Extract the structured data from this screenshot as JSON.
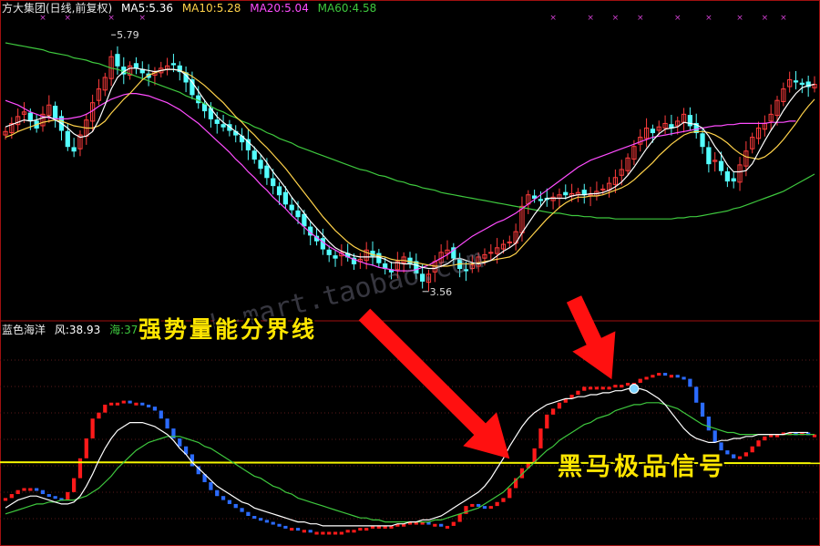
{
  "colors": {
    "background": "#000000",
    "frame": "#a01010",
    "grid": "#5a1a1a",
    "up_candle": "#ff3c3c",
    "down_candle": "#54ffff",
    "ma5": "#ffffff",
    "ma10": "#ffd24a",
    "ma20": "#ff4cff",
    "ma60": "#3ec83e",
    "osc_up": "#ff1a1a",
    "osc_down": "#2b6bff",
    "osc_fast": "#ffffff",
    "osc_slow": "#3ec83e",
    "threshold": "#f5f500",
    "arrow": "#ff1010",
    "signal_dot": "#7fd4ff",
    "marker": "#d040d0"
  },
  "top_panel": {
    "title": "方大集团(日线,前复权)",
    "ma5_label": "MA5:5.36",
    "ma10_label": "MA10:5.28",
    "ma20_label": "MA20:5.04",
    "ma60_label": "MA60:4.58",
    "high_label": "5.79",
    "low_label": "3.56"
  },
  "bottom_panel": {
    "title": "蓝色海洋",
    "feng_label": "风:38.93",
    "hai_label": "海:37.04"
  },
  "annotations": {
    "left_text": "强势量能分界线",
    "right_text": "黑马极品信号",
    "watermark": "zb-mart.taobao.com"
  },
  "chart_data": [
    {
      "type": "candlestick",
      "title": "方大集团(日线,前复权)",
      "series_names": [
        "MA5",
        "MA10",
        "MA20",
        "MA60"
      ],
      "ylim": [
        3.4,
        5.95
      ],
      "extremes": {
        "high": 5.79,
        "low": 3.56
      },
      "close": [
        4.95,
        5.02,
        5.08,
        5.12,
        5.05,
        4.98,
        5.1,
        5.18,
        5.06,
        4.96,
        4.82,
        4.78,
        4.92,
        5.05,
        5.2,
        5.32,
        5.42,
        5.6,
        5.52,
        5.45,
        5.52,
        5.5,
        5.46,
        5.42,
        5.47,
        5.5,
        5.52,
        5.53,
        5.47,
        5.38,
        5.27,
        5.2,
        5.13,
        5.06,
        5.02,
        4.99,
        4.96,
        4.92,
        4.86,
        4.79,
        4.71,
        4.63,
        4.55,
        4.48,
        4.4,
        4.32,
        4.27,
        4.21,
        4.13,
        4.05,
        4.0,
        3.93,
        3.88,
        3.85,
        3.9,
        3.86,
        3.8,
        3.84,
        3.92,
        3.87,
        3.81,
        3.76,
        3.73,
        3.82,
        3.86,
        3.8,
        3.72,
        3.65,
        3.71,
        3.82,
        3.9,
        3.92,
        3.85,
        3.76,
        3.74,
        3.79,
        3.86,
        3.88,
        3.9,
        3.94,
        3.97,
        3.99,
        4.08,
        4.3,
        4.4,
        4.37,
        4.35,
        4.36,
        4.38,
        4.4,
        4.4,
        4.41,
        4.42,
        4.4,
        4.4,
        4.43,
        4.45,
        4.5,
        4.55,
        4.62,
        4.72,
        4.82,
        4.9,
        4.98,
        4.94,
        4.99,
        5.02,
        4.98,
        5.04,
        5.1,
        5.0,
        4.94,
        4.82,
        4.67,
        4.7,
        4.61,
        4.52,
        4.52,
        4.66,
        4.78,
        4.9,
        4.98,
        5.02,
        5.1,
        5.22,
        5.32,
        5.4,
        5.38,
        5.36,
        5.34,
        5.36
      ],
      "ma5": [
        4.99,
        5.01,
        5.03,
        5.05,
        5.04,
        5.05,
        5.07,
        5.08,
        5.05,
        5.02,
        4.98,
        4.93,
        4.9,
        4.91,
        4.95,
        5.05,
        5.18,
        5.32,
        5.42,
        5.47,
        5.5,
        5.5,
        5.49,
        5.48,
        5.47,
        5.48,
        5.49,
        5.49,
        5.48,
        5.44,
        5.38,
        5.3,
        5.22,
        5.15,
        5.08,
        5.03,
        4.99,
        4.95,
        4.91,
        4.86,
        4.81,
        4.75,
        4.68,
        4.6,
        4.53,
        4.46,
        4.38,
        4.31,
        4.24,
        4.17,
        4.11,
        4.05,
        3.99,
        3.94,
        3.91,
        3.89,
        3.87,
        3.86,
        3.86,
        3.86,
        3.86,
        3.84,
        3.81,
        3.81,
        3.8,
        3.8,
        3.79,
        3.77,
        3.76,
        3.76,
        3.78,
        3.8,
        3.84,
        3.85,
        3.83,
        3.81,
        3.8,
        3.81,
        3.83,
        3.87,
        3.91,
        3.94,
        3.98,
        4.07,
        4.15,
        4.23,
        4.3,
        4.37,
        4.37,
        4.37,
        4.37,
        4.39,
        4.4,
        4.4,
        4.41,
        4.41,
        4.42,
        4.44,
        4.47,
        4.51,
        4.57,
        4.64,
        4.72,
        4.8,
        4.87,
        4.93,
        4.97,
        4.98,
        4.99,
        5.03,
        5.02,
        5.01,
        4.98,
        4.91,
        4.82,
        4.75,
        4.66,
        4.6,
        4.6,
        4.61,
        4.67,
        4.77,
        4.87,
        4.96,
        5.04,
        5.13,
        5.21,
        5.28,
        5.33,
        5.35,
        5.36
      ],
      "ma10": [
        4.9,
        4.92,
        4.95,
        4.97,
        4.99,
        5.01,
        5.03,
        5.04,
        5.05,
        5.04,
        5.02,
        5.0,
        4.99,
        4.98,
        4.98,
        5.0,
        5.04,
        5.11,
        5.17,
        5.23,
        5.28,
        5.34,
        5.4,
        5.44,
        5.46,
        5.48,
        5.49,
        5.49,
        5.48,
        5.46,
        5.43,
        5.39,
        5.35,
        5.3,
        5.25,
        5.2,
        5.14,
        5.08,
        5.03,
        4.97,
        4.92,
        4.86,
        4.81,
        4.75,
        4.69,
        4.63,
        4.56,
        4.49,
        4.42,
        4.35,
        4.28,
        4.21,
        4.15,
        4.09,
        4.04,
        3.99,
        3.95,
        3.92,
        3.9,
        3.88,
        3.87,
        3.86,
        3.84,
        3.83,
        3.83,
        3.82,
        3.81,
        3.8,
        3.79,
        3.78,
        3.78,
        3.78,
        3.79,
        3.8,
        3.8,
        3.8,
        3.81,
        3.82,
        3.83,
        3.84,
        3.85,
        3.86,
        3.89,
        3.95,
        4.01,
        4.07,
        4.13,
        4.19,
        4.24,
        4.29,
        4.33,
        4.36,
        4.38,
        4.38,
        4.39,
        4.39,
        4.4,
        4.42,
        4.44,
        4.46,
        4.49,
        4.53,
        4.58,
        4.63,
        4.68,
        4.74,
        4.79,
        4.84,
        4.88,
        4.92,
        4.94,
        4.95,
        4.95,
        4.94,
        4.92,
        4.89,
        4.85,
        4.8,
        4.76,
        4.73,
        4.72,
        4.71,
        4.73,
        4.77,
        4.82,
        4.88,
        4.95,
        5.02,
        5.1,
        5.17,
        5.23
      ],
      "ma20": [
        5.22,
        5.2,
        5.18,
        5.15,
        5.12,
        5.1,
        5.08,
        5.07,
        5.06,
        5.06,
        5.06,
        5.07,
        5.08,
        5.1,
        5.13,
        5.17,
        5.2,
        5.23,
        5.25,
        5.27,
        5.28,
        5.28,
        5.27,
        5.26,
        5.24,
        5.22,
        5.2,
        5.17,
        5.14,
        5.1,
        5.06,
        5.02,
        4.97,
        4.92,
        4.87,
        4.82,
        4.77,
        4.71,
        4.66,
        4.6,
        4.55,
        4.49,
        4.44,
        4.38,
        4.33,
        4.28,
        4.22,
        4.17,
        4.12,
        4.07,
        4.03,
        3.99,
        3.95,
        3.92,
        3.89,
        3.86,
        3.84,
        3.82,
        3.8,
        3.79,
        3.77,
        3.76,
        3.75,
        3.74,
        3.74,
        3.74,
        3.75,
        3.77,
        3.79,
        3.82,
        3.85,
        3.88,
        3.92,
        3.96,
        4.0,
        4.04,
        4.07,
        4.1,
        4.13,
        4.16,
        4.18,
        4.21,
        4.24,
        4.28,
        4.32,
        4.36,
        4.4,
        4.44,
        4.48,
        4.52,
        4.56,
        4.6,
        4.64,
        4.67,
        4.7,
        4.72,
        4.74,
        4.76,
        4.78,
        4.8,
        4.82,
        4.84,
        4.86,
        4.88,
        4.9,
        4.91,
        4.92,
        4.93,
        4.94,
        4.95,
        4.96,
        4.97,
        4.98,
        4.99,
        5.0,
        5.0,
        5.01,
        5.01,
        5.02,
        5.02,
        5.02,
        5.02,
        5.02,
        5.03,
        5.03,
        5.03,
        5.04,
        5.04
      ],
      "ma60": [
        5.72,
        5.71,
        5.7,
        5.69,
        5.68,
        5.67,
        5.66,
        5.64,
        5.63,
        5.62,
        5.61,
        5.59,
        5.58,
        5.57,
        5.55,
        5.54,
        5.52,
        5.5,
        5.49,
        5.47,
        5.45,
        5.43,
        5.41,
        5.39,
        5.37,
        5.35,
        5.33,
        5.31,
        5.29,
        5.26,
        5.24,
        5.22,
        5.19,
        5.17,
        5.14,
        5.12,
        5.09,
        5.07,
        5.04,
        5.02,
        4.99,
        4.97,
        4.94,
        4.92,
        4.89,
        4.87,
        4.85,
        4.82,
        4.8,
        4.78,
        4.76,
        4.74,
        4.72,
        4.7,
        4.68,
        4.66,
        4.64,
        4.62,
        4.61,
        4.59,
        4.57,
        4.56,
        4.54,
        4.52,
        4.51,
        4.49,
        4.48,
        4.46,
        4.45,
        4.44,
        4.42,
        4.41,
        4.4,
        4.39,
        4.38,
        4.37,
        4.36,
        4.35,
        4.34,
        4.33,
        4.32,
        4.31,
        4.3,
        4.29,
        4.28,
        4.27,
        4.26,
        4.25,
        4.24,
        4.24,
        4.23,
        4.22,
        4.22,
        4.21,
        4.21,
        4.2,
        4.2,
        4.2,
        4.19,
        4.19,
        4.19,
        4.19,
        4.19,
        4.19,
        4.19,
        4.19,
        4.19,
        4.19,
        4.2,
        4.2,
        4.21,
        4.21,
        4.22,
        4.23,
        4.24,
        4.25,
        4.26,
        4.28,
        4.29,
        4.31,
        4.33,
        4.35,
        4.37,
        4.39,
        4.41,
        4.43,
        4.46,
        4.49,
        4.52,
        4.55,
        4.58
      ]
    },
    {
      "type": "line",
      "title": "蓝色海洋",
      "series": [
        {
          "name": "风",
          "last": 38.93
        },
        {
          "name": "海",
          "last": 37.04
        }
      ],
      "ylim": [
        0,
        100
      ],
      "threshold": 38,
      "fast": [
        15,
        17,
        19,
        20,
        21,
        21,
        20,
        19,
        18,
        17,
        17,
        18,
        21,
        26,
        32,
        39,
        45,
        50,
        54,
        56,
        58,
        58,
        58,
        57,
        56,
        54,
        52,
        49,
        45,
        42,
        38,
        35,
        32,
        29,
        26,
        24,
        22,
        20,
        18,
        17,
        15,
        14,
        13,
        12,
        11,
        10,
        9,
        8,
        8,
        7,
        7,
        6,
        6,
        6,
        6,
        6,
        6,
        6,
        6,
        6,
        6,
        6,
        6,
        7,
        7,
        8,
        8,
        9,
        9,
        10,
        11,
        13,
        15,
        17,
        19,
        21,
        23,
        26,
        30,
        35,
        40,
        46,
        51,
        56,
        60,
        63,
        65,
        67,
        68,
        69,
        70,
        70,
        71,
        71,
        72,
        72,
        73,
        73,
        74,
        74,
        75,
        75,
        75,
        74,
        72,
        70,
        67,
        63,
        59,
        55,
        52,
        50,
        49,
        48,
        48,
        49,
        49,
        50,
        50,
        51,
        51,
        52,
        52,
        52,
        52,
        52,
        53,
        53,
        53,
        53
      ],
      "slow": [
        12,
        13,
        14,
        15,
        16,
        17,
        17,
        18,
        18,
        19,
        19,
        19,
        20,
        21,
        23,
        25,
        28,
        31,
        35,
        38,
        41,
        44,
        46,
        48,
        49,
        50,
        51,
        51,
        51,
        50,
        49,
        48,
        46,
        45,
        43,
        41,
        39,
        37,
        35,
        33,
        31,
        30,
        28,
        26,
        25,
        23,
        22,
        20,
        19,
        18,
        17,
        16,
        15,
        14,
        13,
        12,
        11,
        10,
        10,
        9,
        9,
        8,
        8,
        8,
        8,
        8,
        8,
        8,
        8,
        9,
        9,
        10,
        11,
        12,
        13,
        14,
        15,
        17,
        19,
        21,
        23,
        26,
        29,
        32,
        35,
        38,
        41,
        44,
        46,
        49,
        51,
        53,
        55,
        57,
        58,
        60,
        61,
        62,
        64,
        65,
        66,
        67,
        67,
        68,
        68,
        68,
        67,
        66,
        65,
        63,
        61,
        59,
        57,
        56,
        55,
        54,
        53,
        53,
        52,
        52,
        52,
        52,
        52,
        52,
        52,
        52,
        52,
        52,
        52,
        52,
        52
      ],
      "signal": [
        20,
        22,
        24,
        25,
        25,
        24,
        22,
        21,
        20,
        19,
        23,
        30,
        40,
        50,
        60,
        63,
        67,
        68,
        68,
        69,
        68,
        68,
        67,
        66,
        64,
        60,
        55,
        50,
        46,
        42,
        36,
        32,
        28,
        24,
        21,
        19,
        17,
        15,
        13,
        11,
        10,
        9,
        8,
        7,
        6,
        5,
        5,
        4,
        4,
        3,
        3,
        3,
        3,
        3,
        3,
        4,
        4,
        5,
        5,
        6,
        6,
        6,
        6,
        7,
        7,
        8,
        8,
        8,
        7,
        7,
        6,
        6,
        8,
        12,
        16,
        17,
        16,
        15,
        16,
        18,
        20,
        25,
        30,
        35,
        38,
        45,
        55,
        62,
        65,
        68,
        70,
        72,
        74,
        76,
        76,
        76,
        76,
        76,
        77,
        77,
        78,
        78,
        80,
        81,
        82,
        83,
        82,
        82,
        81,
        80,
        76,
        68,
        61,
        54,
        48,
        44,
        42,
        40,
        41,
        43,
        46,
        49,
        51,
        52,
        52,
        53,
        53,
        52,
        53,
        52,
        52
      ]
    }
  ]
}
